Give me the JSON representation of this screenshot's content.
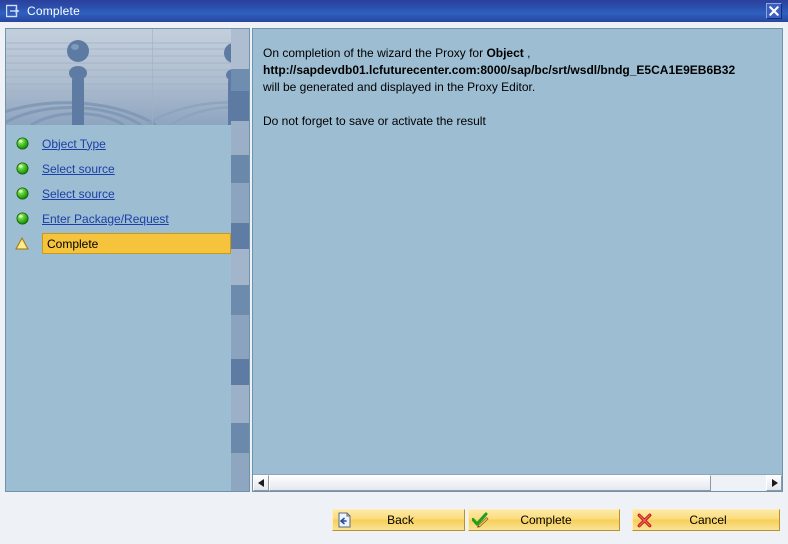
{
  "window": {
    "title": "Complete",
    "title_icon": "wizard-window-icon",
    "close_icon": "close-icon"
  },
  "banner": {
    "name": "water-droplet-ripple-banner",
    "description": "Water droplet splash with ripples"
  },
  "roadmap": {
    "steps": [
      {
        "label": "Object Type",
        "status": "done",
        "icon": "green-sphere-icon"
      },
      {
        "label": "Select source",
        "status": "done",
        "icon": "green-sphere-icon"
      },
      {
        "label": "Select source",
        "status": "done",
        "icon": "green-sphere-icon"
      },
      {
        "label": "Enter Package/Request",
        "status": "done",
        "icon": "green-sphere-icon"
      },
      {
        "label": "Complete",
        "status": "current",
        "icon": "yellow-warning-triangle-icon"
      }
    ]
  },
  "message": {
    "line1_prefix": "On completion of the wizard the Proxy for ",
    "line1_bold": "Object",
    "line1_suffix": " ,",
    "line2_bold": "http://sapdevdb01.lcfuturecenter.com:8000/sap/bc/srt/wsdl/bndg_E5CA1E9EB6B32",
    "line3": "will be generated and displayed in the Proxy Editor.",
    "line4": "Do not forget to save or activate the result"
  },
  "scrollbar": {
    "left_arrow_icon": "scroll-left-arrow-icon",
    "right_arrow_icon": "scroll-right-arrow-icon",
    "thumb_name": "horizontal-scroll-thumb"
  },
  "footer": {
    "buttons": [
      {
        "label": "Back",
        "icon": "back-document-icon"
      },
      {
        "label": "Complete",
        "icon": "green-check-pencil-icon"
      },
      {
        "label": "Cancel",
        "icon": "red-x-icon"
      }
    ]
  },
  "colors": {
    "titlebar": "#2a51ad",
    "panel_bg": "#9dbdd2",
    "highlight": "#f5c33c",
    "link": "#1b3fa8",
    "button_gold": "#fbdc7d",
    "footer_bg": "#eef2f7"
  }
}
